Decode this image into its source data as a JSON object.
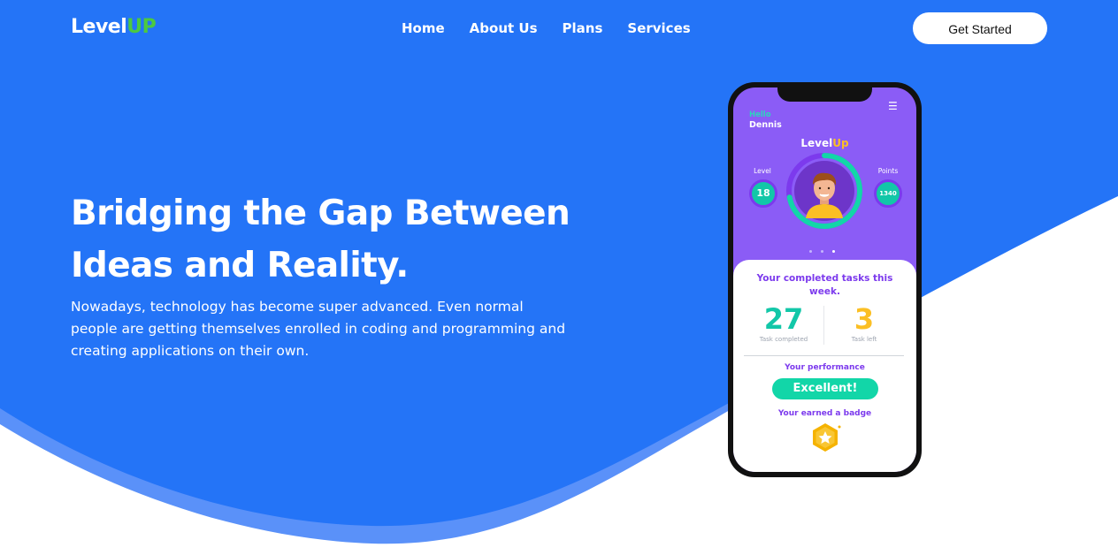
{
  "colors": {
    "primary_blue": "#2474f7",
    "wave_light": "#5a91f9",
    "brand_green": "#4cc93f",
    "phone_purple": "#8b5cf6",
    "teal": "#12c7a8",
    "amber": "#fbbf24"
  },
  "header": {
    "logo_part1": "Level",
    "logo_part2": "UP",
    "nav": [
      {
        "label": "Home"
      },
      {
        "label": "About Us"
      },
      {
        "label": "Plans"
      },
      {
        "label": "Services"
      }
    ],
    "cta_label": "Get Started"
  },
  "hero": {
    "title_line1": "Bridging the Gap Between",
    "title_line2": "Ideas and Reality.",
    "description": "Nowadays, technology has become super advanced. Even normal people are getting themselves enrolled in coding and programming and creating applications on their own."
  },
  "phone": {
    "greeting": "Hello",
    "user_name": "Dennis",
    "app_logo_part1": "Level",
    "app_logo_part2": "Up",
    "menu_icon": "hamburger-icon",
    "level_label": "Level",
    "level_value": "18",
    "points_label": "Points",
    "points_value": "1340",
    "progress_fraction": 0.72,
    "carousel_active_index": 2,
    "card": {
      "title": "Your completed tasks this week.",
      "completed_value": "27",
      "completed_caption": "Task completed",
      "left_value": "3",
      "left_caption": "Task left",
      "performance_title": "Your performance",
      "performance_value": "Excellent!",
      "badge_title": "Your earned a badge",
      "badge_icon": "star-badge-icon"
    }
  }
}
